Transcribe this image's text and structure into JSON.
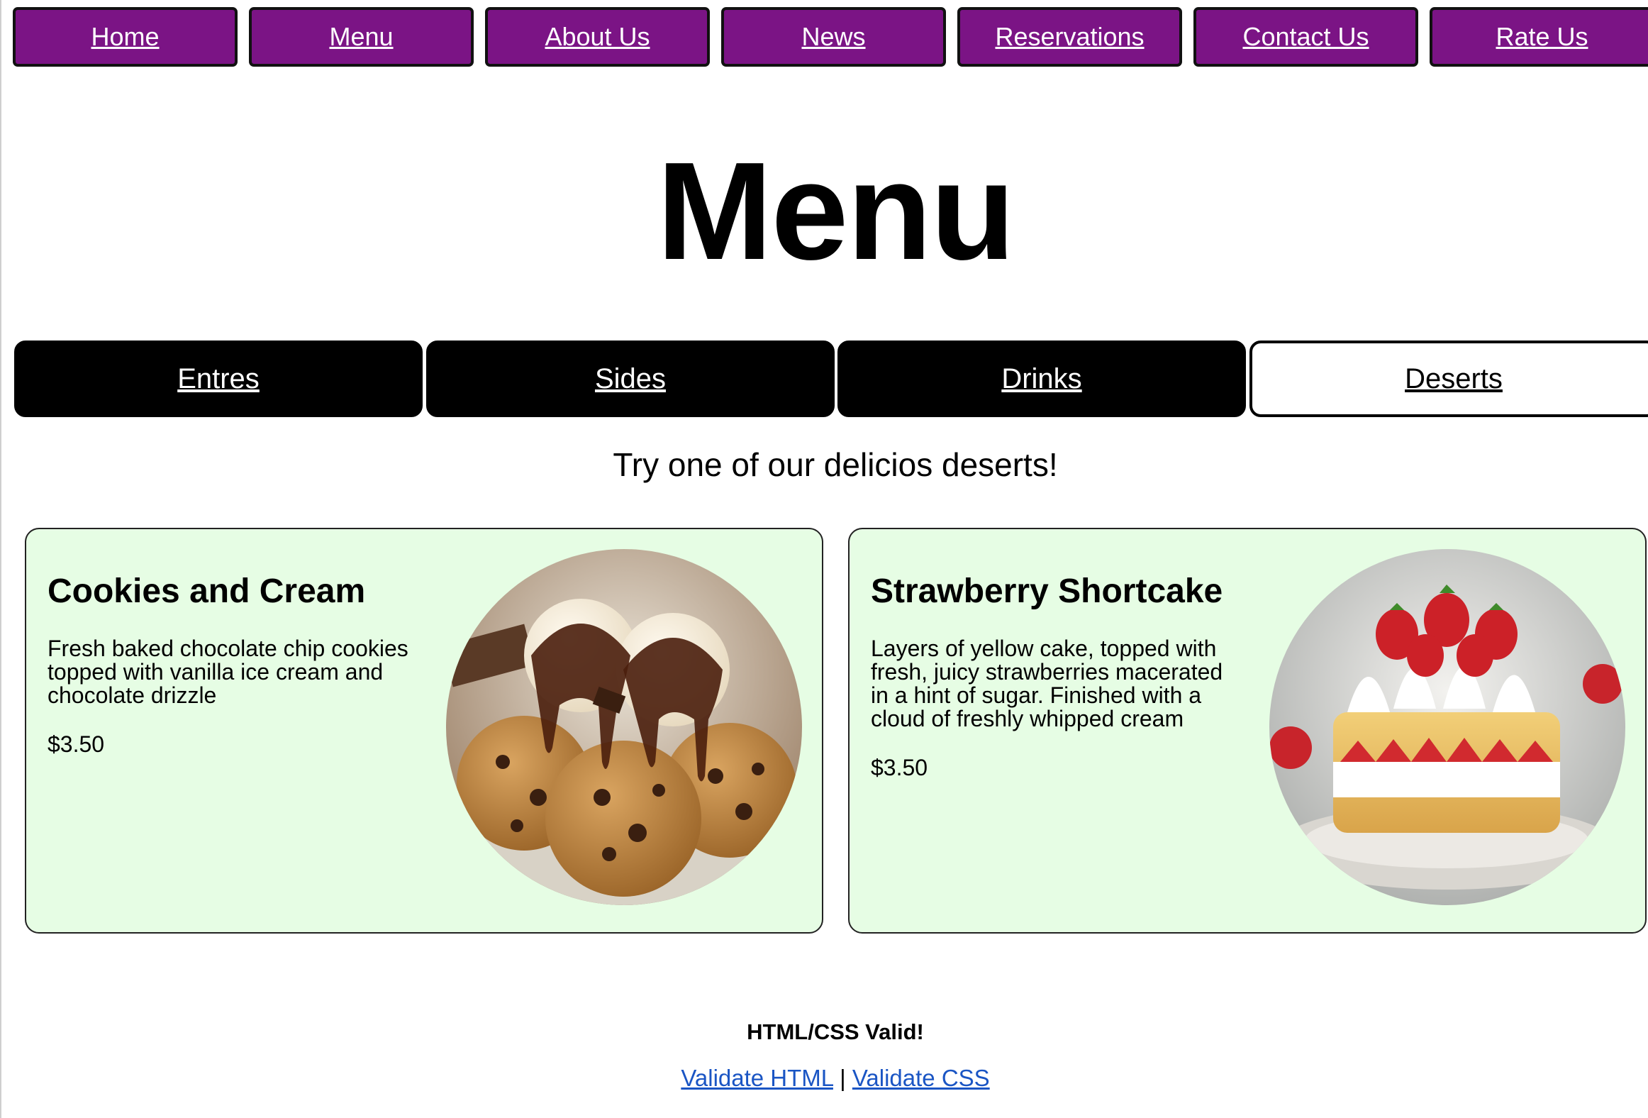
{
  "nav": {
    "items": [
      "Home",
      "Menu",
      "About Us",
      "News",
      "Reservations",
      "Contact Us",
      "Rate Us"
    ]
  },
  "page_title": "Menu",
  "tabs": [
    {
      "label": "Entres",
      "active": false
    },
    {
      "label": "Sides",
      "active": false
    },
    {
      "label": "Drinks",
      "active": false
    },
    {
      "label": "Deserts",
      "active": true
    }
  ],
  "intro": "Try one of our delicios deserts!",
  "items": [
    {
      "title": "Cookies and Cream",
      "description": "Fresh baked chocolate chip cookies topped with vanilla ice cream and chocolate drizzle",
      "price": "$3.50",
      "image": "cookies-and-cream-photo"
    },
    {
      "title": "Strawberry Shortcake",
      "description": "Layers of yellow cake, topped with fresh, juicy strawberries macerated in a hint of sugar. Finished with a cloud of freshly whipped cream",
      "price": "$3.50",
      "image": "strawberry-shortcake-photo"
    }
  ],
  "footer": {
    "valid_text": "HTML/CSS Valid!",
    "validate_html": "Validate HTML",
    "separator": "|",
    "validate_css": "Validate CSS"
  },
  "colors": {
    "nav_bg": "#7b1485",
    "tab_bg": "#000000",
    "card_bg": "#e6fde4",
    "link": "#1a55c4"
  }
}
